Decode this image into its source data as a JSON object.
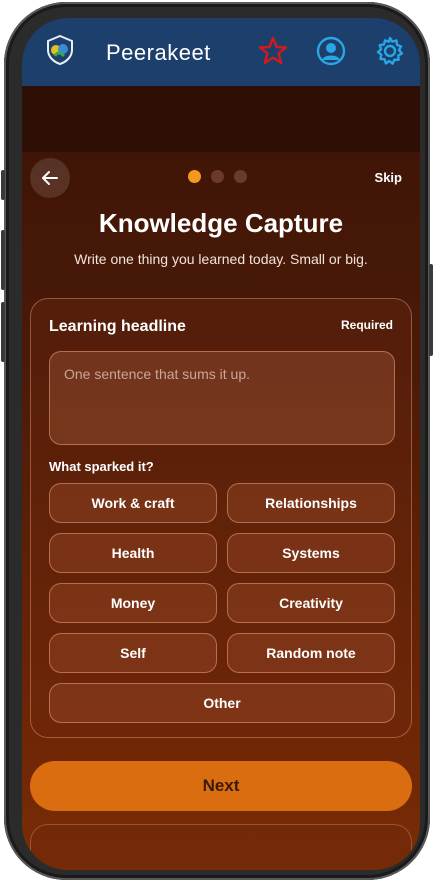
{
  "app": {
    "title": "Peerakeet",
    "icons": [
      "shield-logo-icon",
      "star-icon",
      "profile-icon",
      "gear-icon"
    ],
    "colors": {
      "header": "#1c3f6c",
      "accent": "#f39a1e",
      "next_button": "#d96d10",
      "star": "#d11a1a",
      "icon_blue": "#2aa6e6"
    }
  },
  "nav": {
    "back_icon": "arrow-left-icon",
    "skip_label": "Skip",
    "progress": {
      "total_steps": 3,
      "current_step": 1
    }
  },
  "page": {
    "title": "Knowledge Capture",
    "subtitle": "Write one thing you learned today. Small or big."
  },
  "form": {
    "headline_label": "Learning headline",
    "required_label": "Required",
    "headline_value": "",
    "headline_placeholder": "One sentence that sums it up.",
    "spark_label": "What sparked it?",
    "spark_options": [
      "Work & craft",
      "Relationships",
      "Health",
      "Systems",
      "Money",
      "Creativity",
      "Self",
      "Random note",
      "Other"
    ]
  },
  "footer": {
    "next_label": "Next"
  }
}
